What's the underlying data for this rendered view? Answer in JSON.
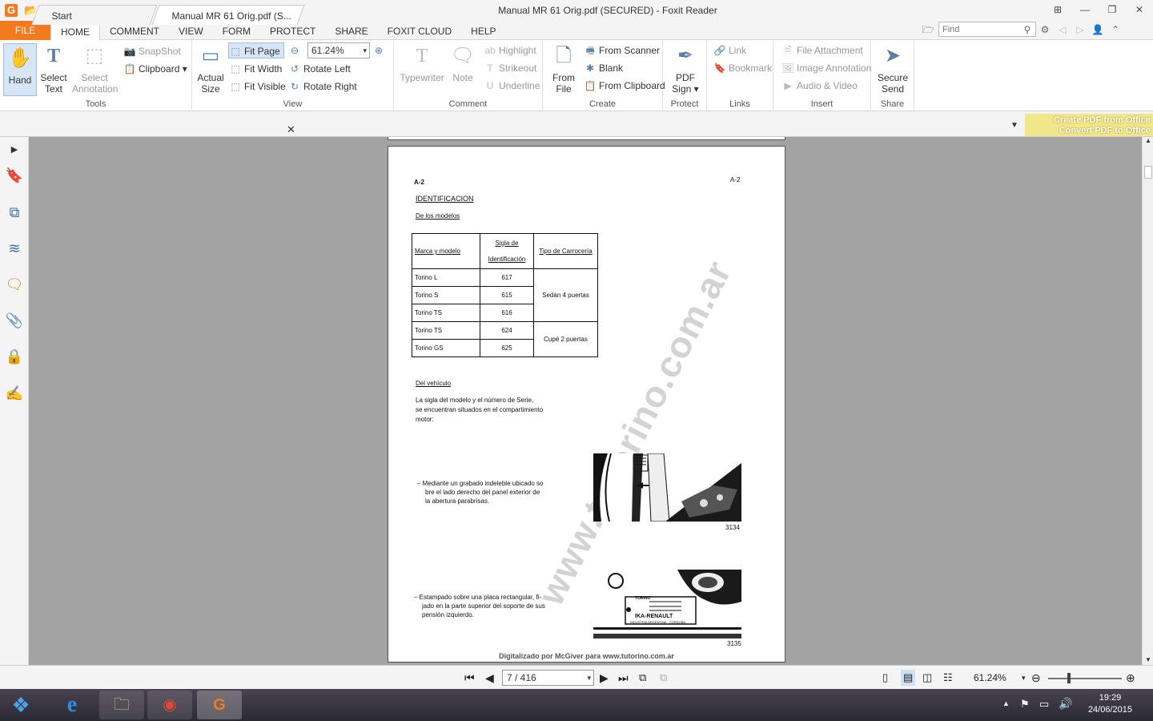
{
  "window": {
    "title": "Manual MR 61 Orig.pdf (SECURED) - Foxit Reader"
  },
  "menu": {
    "file": "FILE",
    "items": [
      "HOME",
      "COMMENT",
      "VIEW",
      "FORM",
      "PROTECT",
      "SHARE",
      "FOXIT CLOUD",
      "HELP"
    ]
  },
  "search": {
    "placeholder": "Find"
  },
  "ribbon": {
    "tools": {
      "label": "Tools",
      "hand": "Hand",
      "select_text_1": "Select",
      "select_text_2": "Text",
      "select_annotation_1": "Select",
      "select_annotation_2": "Annotation",
      "snapshot": "SnapShot",
      "clipboard": "Clipboard"
    },
    "view": {
      "label": "View",
      "actual_size_1": "Actual",
      "actual_size_2": "Size",
      "fit_page": "Fit Page",
      "fit_width": "Fit Width",
      "fit_visible": "Fit Visible",
      "zoom": "61.24%",
      "rotate_left": "Rotate Left",
      "rotate_right": "Rotate Right"
    },
    "comment": {
      "label": "Comment",
      "typewriter": "Typewriter",
      "note": "Note",
      "highlight": "Highlight",
      "strikeout": "Strikeout",
      "underline": "Underline"
    },
    "create": {
      "label": "Create",
      "from_file_1": "From",
      "from_file_2": "File",
      "from_scanner": "From Scanner",
      "blank": "Blank",
      "from_clipboard": "From Clipboard"
    },
    "protect": {
      "label": "Protect",
      "pdf_sign_1": "PDF",
      "pdf_sign_2": "Sign"
    },
    "links": {
      "label": "Links",
      "link": "Link",
      "bookmark": "Bookmark"
    },
    "insert": {
      "label": "Insert",
      "file_attachment": "File Attachment",
      "image_annotation": "Image Annotation",
      "audio_video": "Audio & Video"
    },
    "share": {
      "label": "Share",
      "secure_send_1": "Secure",
      "secure_send_2": "Send"
    }
  },
  "tabs": {
    "start": "Start",
    "document": "Manual MR 61 Orig.pdf (S..."
  },
  "promo": {
    "line1": "Create PDF from Office",
    "line2": "Convert PDF to Office"
  },
  "pdf": {
    "header_left": "A-2",
    "header_right": "A-2",
    "heading": "IDENTIFICACION",
    "subheading_models": "De los modelos",
    "table": {
      "headers": [
        "Marca y modelo",
        "Sigla de Identificación",
        "Tipo de Carrocería"
      ],
      "rows": [
        [
          "Torino L",
          "617"
        ],
        [
          "Torino S",
          "615"
        ],
        [
          "Torino TS",
          "616"
        ],
        [
          "Torino TS",
          "624"
        ],
        [
          "Torino GS",
          "625"
        ]
      ],
      "body_types": [
        "Sedán 4 puertas",
        "Cupé 2 puertas"
      ]
    },
    "subheading_vehicle": "Del vehículo",
    "para1": [
      "La sigla del modelo y el número de Serie,",
      "se encuentran situados en el compartimiento",
      "motor:"
    ],
    "para2": [
      "– Mediante un grabado indeleble ubicado so",
      "bre el lado derecho del panel exterior de",
      "la abertura parabrisas."
    ],
    "para3": [
      "– Estampado sobre una placa rectangular, fi-",
      "jado en la parte superior del soporte de sus",
      "pensión izquierdo."
    ],
    "fig1": "3134",
    "fig2": "3135",
    "plate_brand": "IKA-RENAULT",
    "plate_model": "TORINO",
    "plate_footer": "INDUSTRIA ARGENTINA · CORDOBA",
    "watermark": "www.tutorino.com.ar",
    "footer": "Digitalizado por McGiver para www.tutorino.com.ar"
  },
  "navigation": {
    "page": "7 / 416",
    "zoom": "61.24%"
  },
  "taskbar": {
    "time": "19:29",
    "date": "24/06/2015"
  }
}
